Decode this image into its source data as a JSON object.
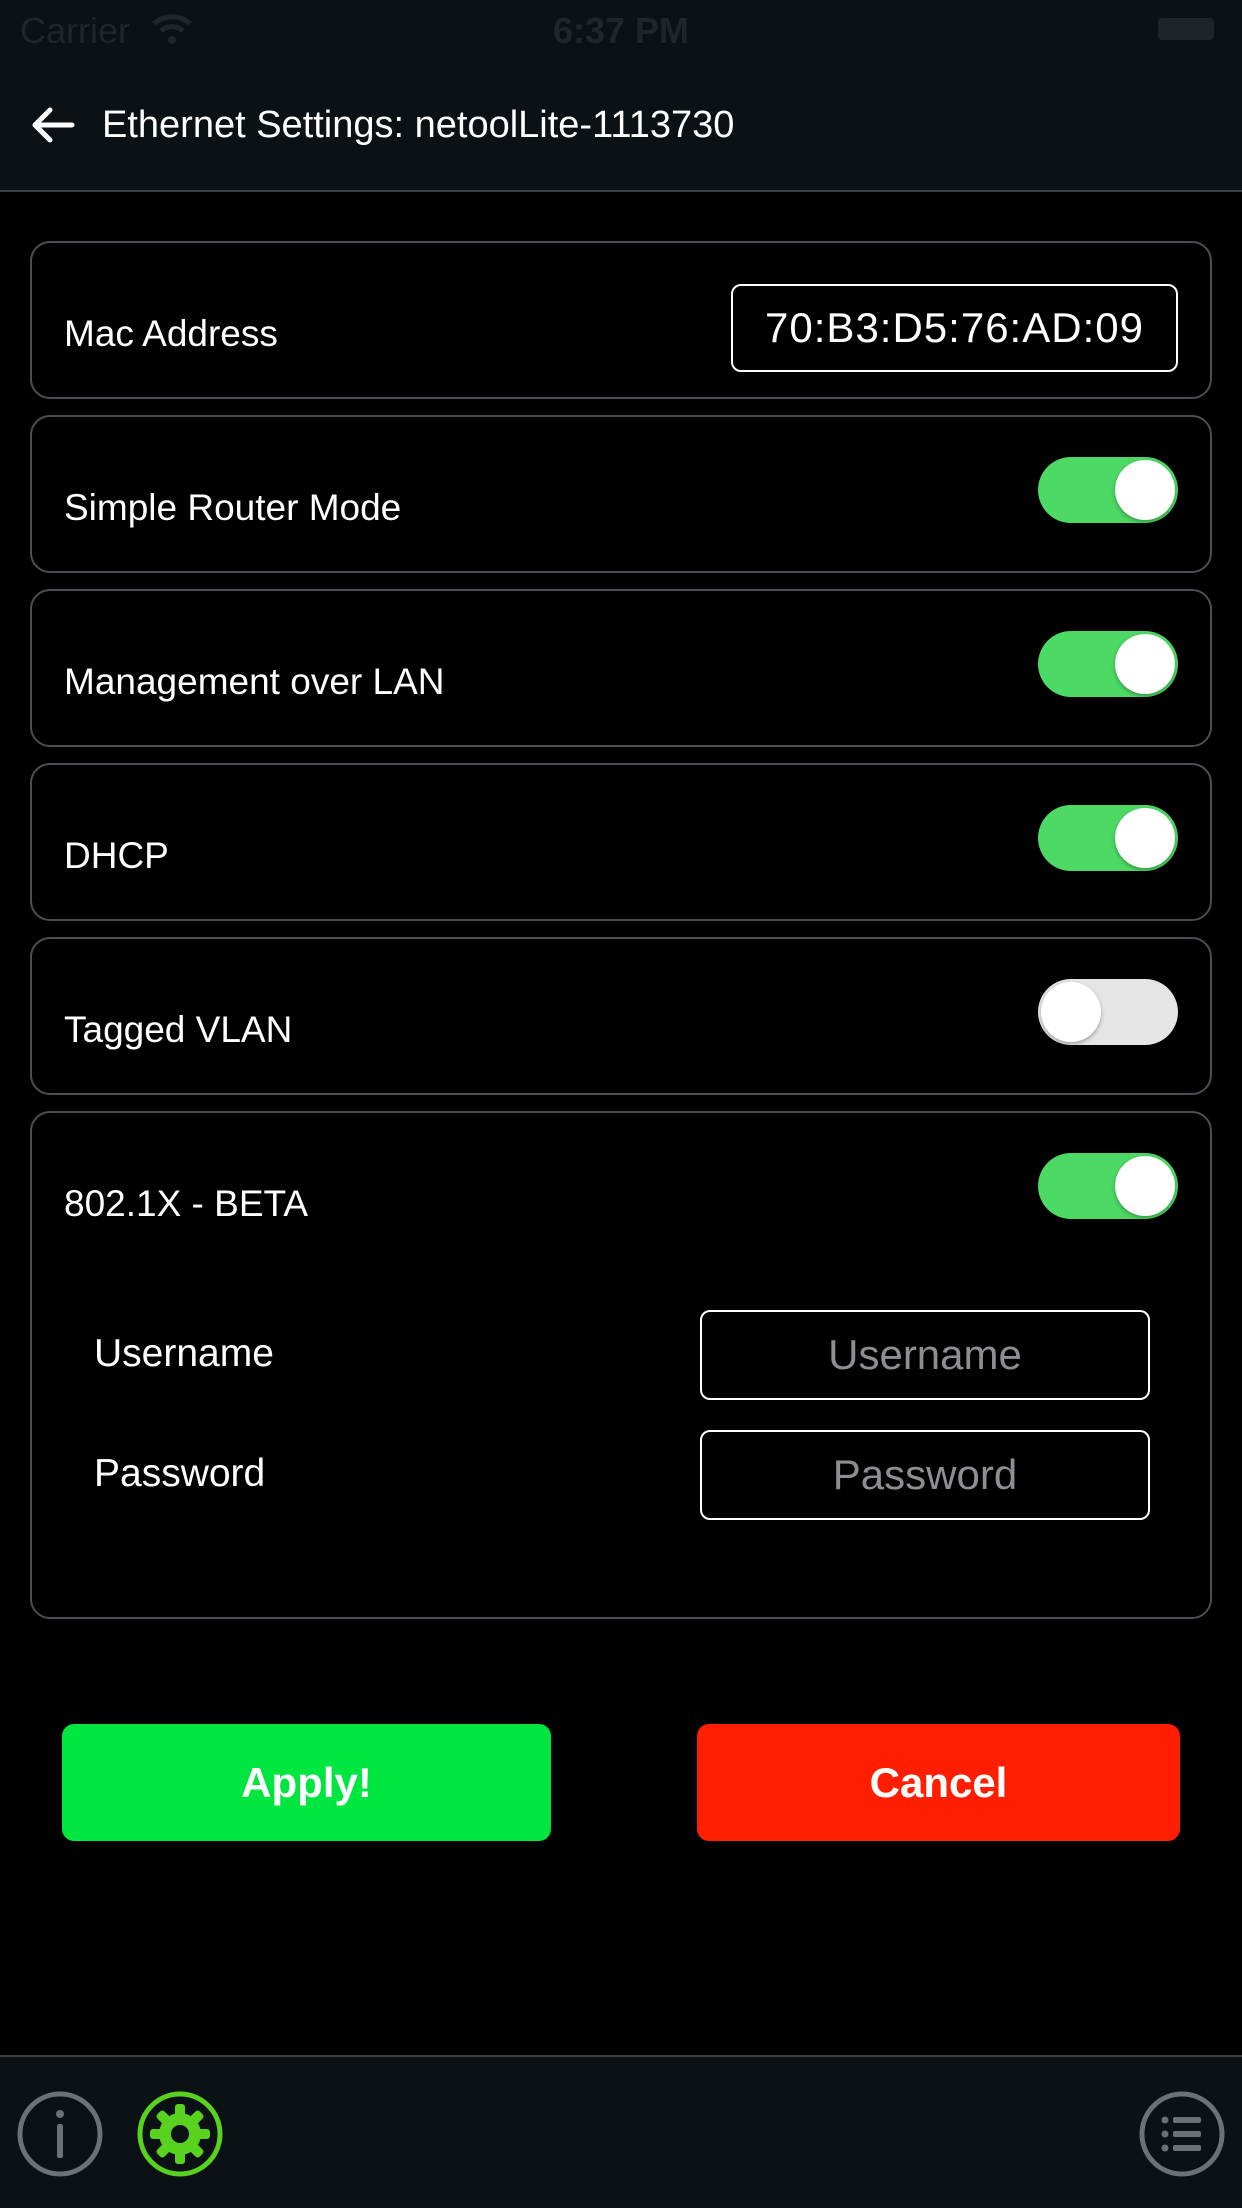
{
  "status_bar": {
    "carrier": "Carrier",
    "time": "6:37 PM"
  },
  "header": {
    "title": "Ethernet Settings: netoolLite-1113730"
  },
  "settings": {
    "mac_address": {
      "label": "Mac Address",
      "value": "70:B3:D5:76:AD:09"
    },
    "simple_router_mode": {
      "label": "Simple Router Mode",
      "enabled": true
    },
    "management_over_lan": {
      "label": "Management over LAN",
      "enabled": true
    },
    "dhcp": {
      "label": "DHCP",
      "enabled": true
    },
    "tagged_vlan": {
      "label": "Tagged VLAN",
      "enabled": false
    },
    "dot1x": {
      "label": "802.1X - BETA",
      "enabled": true,
      "username": {
        "label": "Username",
        "value": "",
        "placeholder": "Username"
      },
      "password": {
        "label": "Password",
        "value": "",
        "placeholder": "Password"
      }
    }
  },
  "actions": {
    "apply_label": "Apply!",
    "cancel_label": "Cancel"
  },
  "tab_bar": {
    "items": [
      {
        "icon": "info-icon",
        "active": false
      },
      {
        "icon": "gear-icon",
        "active": true
      },
      {
        "icon": "list-icon",
        "active": false
      }
    ]
  },
  "colors": {
    "background": "#000000",
    "bar_background": "#0b1114",
    "toggle_on": "#4cd964",
    "toggle_off": "#e5e5e5",
    "apply": "#00e640",
    "cancel": "#ff1f00",
    "active_tab": "#58d21e",
    "inactive_tab": "#6e7174"
  }
}
